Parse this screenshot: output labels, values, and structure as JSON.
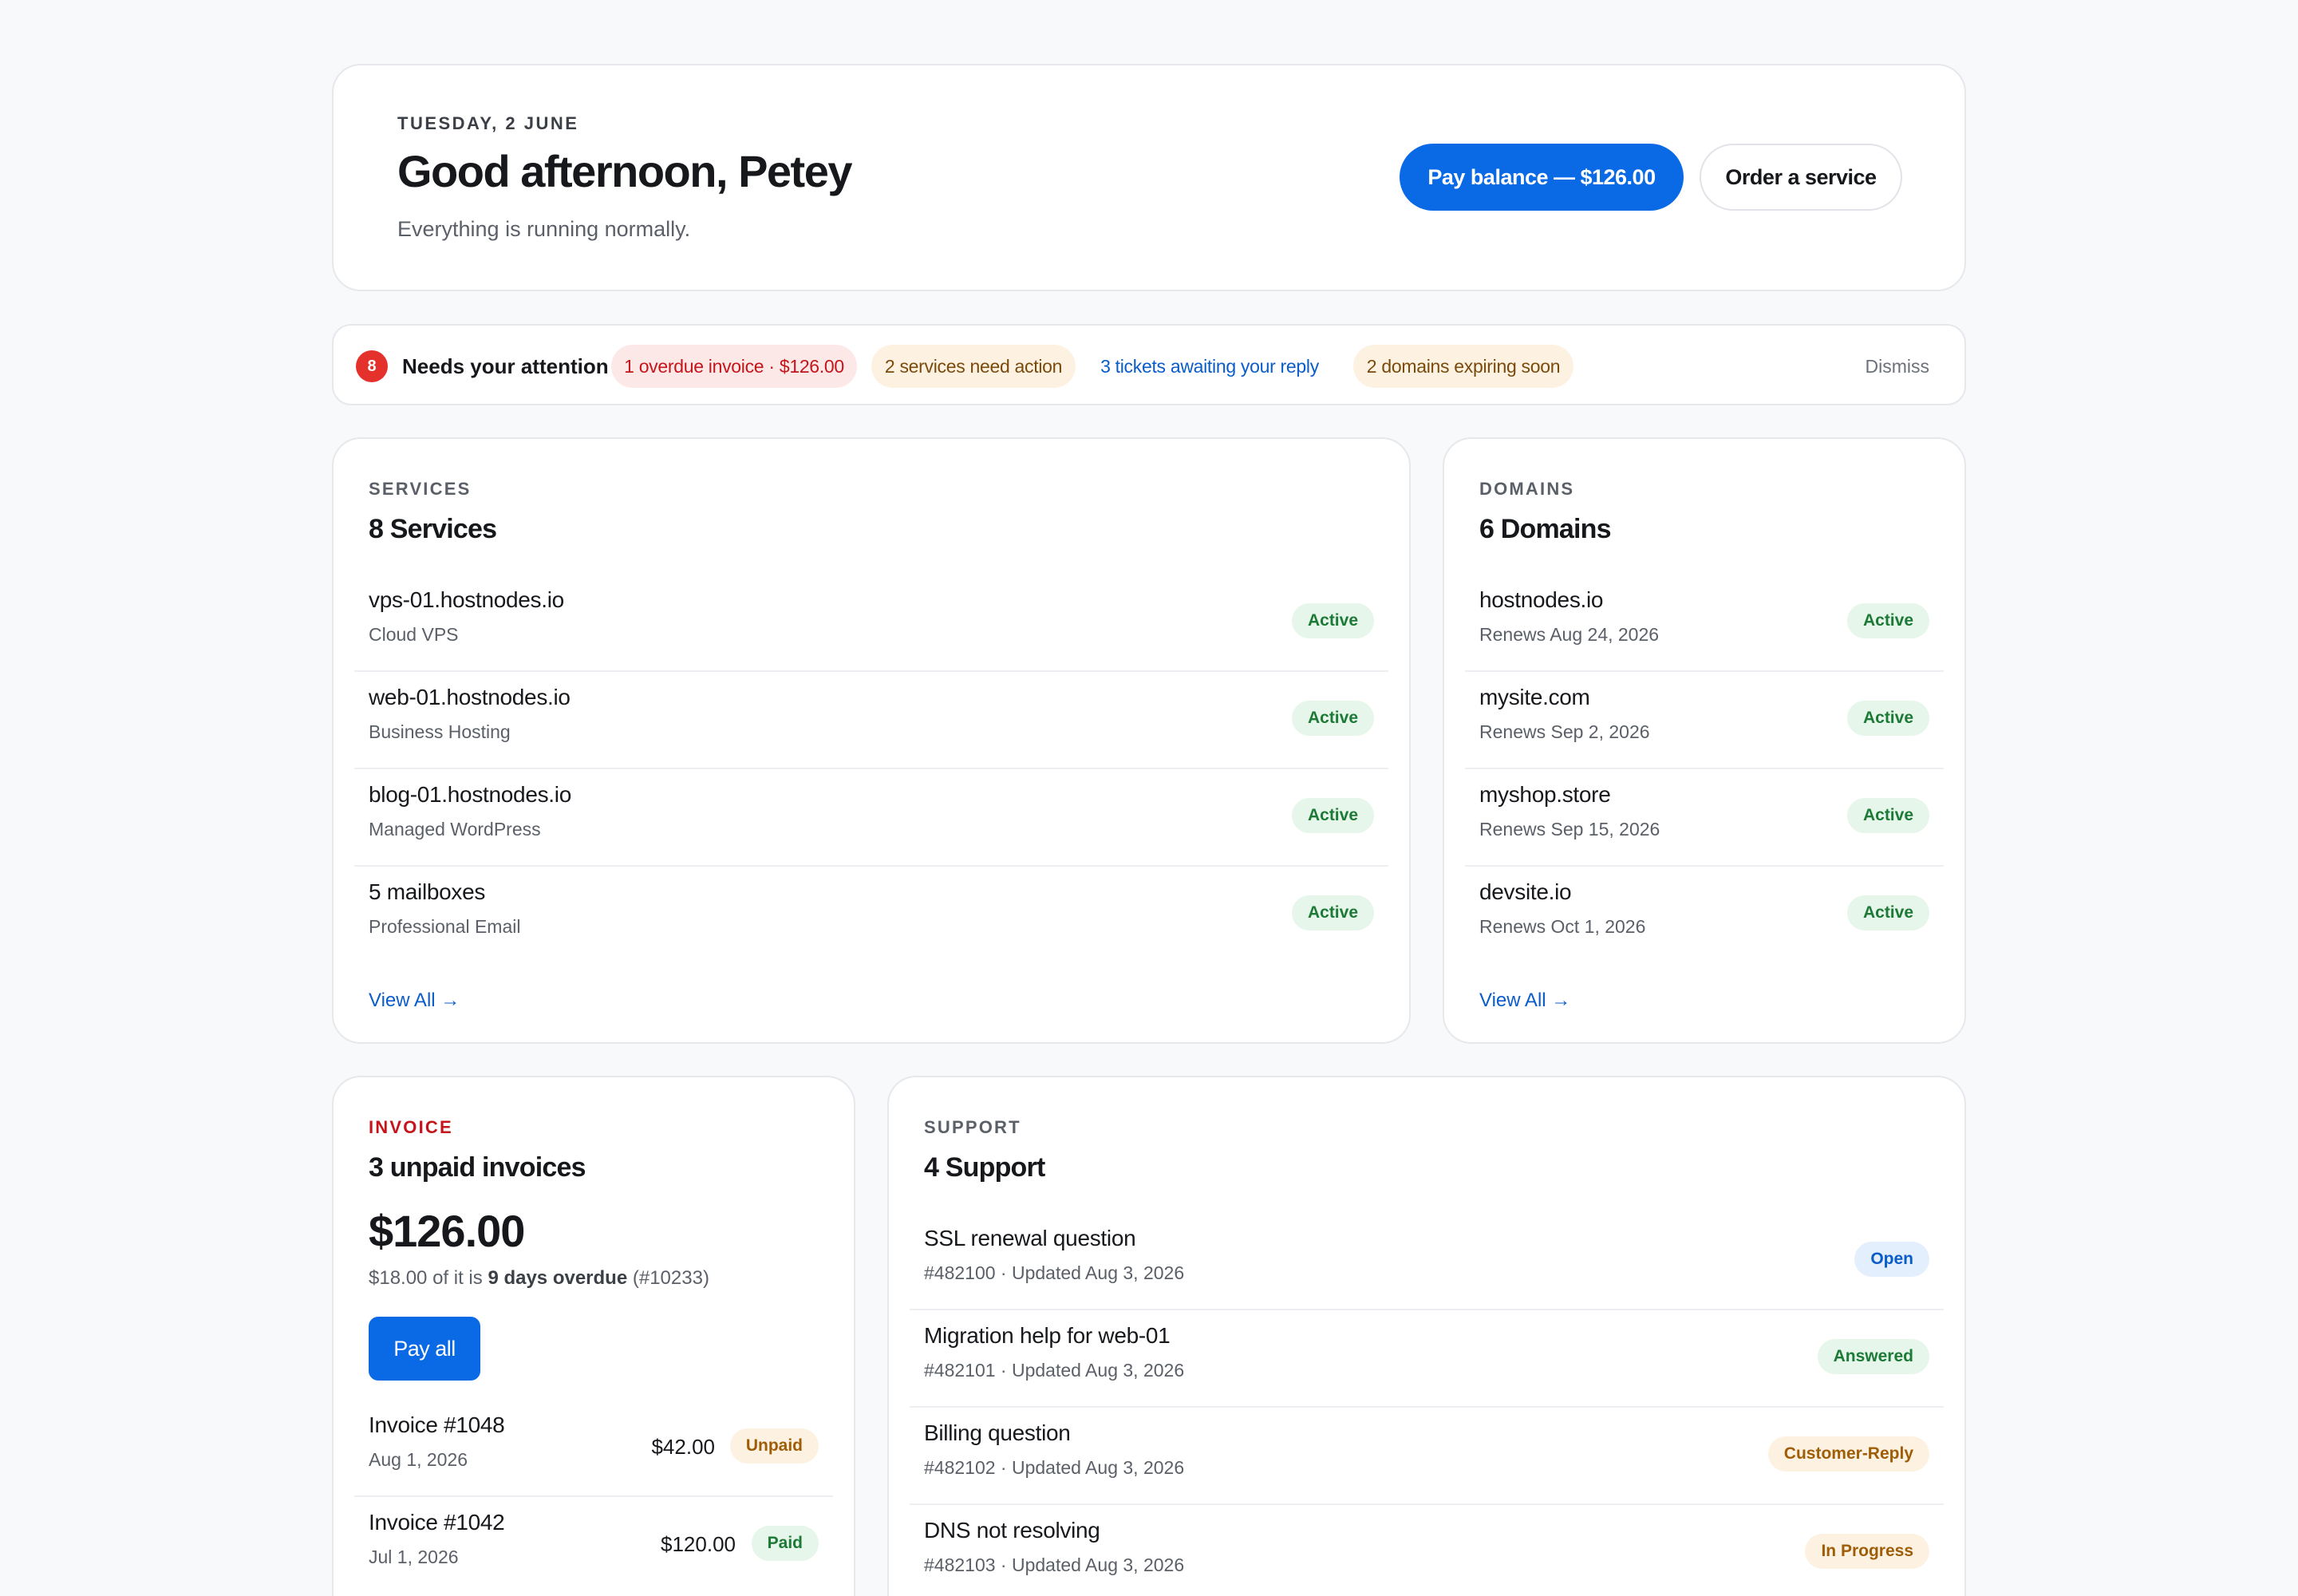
{
  "hero": {
    "date": "TUESDAY, 2 JUNE",
    "greeting": "Good afternoon, Petey",
    "status": "Everything is running normally.",
    "pay_button": "Pay balance — $126.00",
    "order_button": "Order a service"
  },
  "attention": {
    "count": "8",
    "title": "Needs your attention",
    "chips": [
      "1 overdue invoice · $126.00",
      "2 services need action",
      "3 tickets awaiting your reply",
      "2 domains expiring soon"
    ],
    "dismiss": "Dismiss"
  },
  "services": {
    "label": "SERVICES",
    "title": "8 Services",
    "items": [
      {
        "name": "vps-01.hostnodes.io",
        "type": "Cloud VPS",
        "status": "Active"
      },
      {
        "name": "web-01.hostnodes.io",
        "type": "Business Hosting",
        "status": "Active"
      },
      {
        "name": "blog-01.hostnodes.io",
        "type": "Managed WordPress",
        "status": "Active"
      },
      {
        "name": "5 mailboxes",
        "type": "Professional Email",
        "status": "Active"
      }
    ],
    "view_all": "View All →"
  },
  "domains": {
    "label": "DOMAINS",
    "title": "6 Domains",
    "items": [
      {
        "name": "hostnodes.io",
        "renews": "Renews Aug 24, 2026",
        "status": "Active"
      },
      {
        "name": "mysite.com",
        "renews": "Renews Sep 2, 2026",
        "status": "Active"
      },
      {
        "name": "myshop.store",
        "renews": "Renews Sep 15, 2026",
        "status": "Active"
      },
      {
        "name": "devsite.io",
        "renews": "Renews Oct 1, 2026",
        "status": "Active"
      }
    ],
    "view_all": "View All →"
  },
  "invoice": {
    "label": "INVOICE",
    "title": "3 unpaid invoices",
    "amount": "$126.00",
    "note_prefix": "$18.00 of it is",
    "note_bold": "9 days overdue",
    "note_suffix": "(#10233)",
    "pay_all": "Pay all",
    "items": [
      {
        "name": "Invoice #1048",
        "date": "Aug 1, 2026",
        "amount": "$42.00",
        "status": "Unpaid"
      },
      {
        "name": "Invoice #1042",
        "date": "Jul 1, 2026",
        "amount": "$120.00",
        "status": "Paid"
      }
    ]
  },
  "support": {
    "label": "SUPPORT",
    "title": "4 Support",
    "items": [
      {
        "subject": "SSL renewal question",
        "meta": "#482100 · Updated Aug 3, 2026",
        "status": "Open"
      },
      {
        "subject": "Migration help for web-01",
        "meta": "#482101 · Updated Aug 3, 2026",
        "status": "Answered"
      },
      {
        "subject": "Billing question",
        "meta": "#482102 · Updated Aug 3, 2026",
        "status": "Customer-Reply"
      },
      {
        "subject": "DNS not resolving",
        "meta": "#482103 · Updated Aug 3, 2026",
        "status": "In Progress"
      }
    ]
  },
  "colors": {
    "primary": "#0a6ae6",
    "background": "#f8f9fb",
    "danger": "#e5312b",
    "success_badge": "#e6f6ea",
    "warning_badge": "#fdf2e1",
    "info_badge": "#e4effd"
  }
}
